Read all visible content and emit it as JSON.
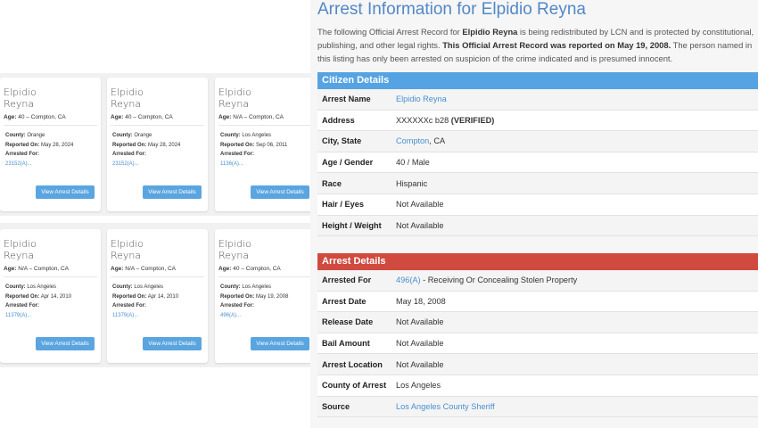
{
  "cards": [
    {
      "first": "Elpidio",
      "last": "Reyna",
      "age_label": "Age:",
      "age_text": "40 – Compton, CA",
      "county_label": "County:",
      "county": "Orange",
      "reported_label": "Reported On:",
      "reported": "May 28, 2024",
      "arrested_label": "Arrested For:",
      "code": "23152(A)...",
      "button": "View Arrest Details"
    },
    {
      "first": "Elpidio",
      "last": "Reyna",
      "age_label": "Age:",
      "age_text": "40 – Compton, CA",
      "county_label": "County:",
      "county": "Orange",
      "reported_label": "Reported On:",
      "reported": "May 28, 2024",
      "arrested_label": "Arrested For:",
      "code": "23152(A)...",
      "button": "View Arrest Details"
    },
    {
      "first": "Elpidio",
      "last": "Reyna",
      "age_label": "Age:",
      "age_text": "N/A – Compton, CA",
      "county_label": "County:",
      "county": "Los Angeles",
      "reported_label": "Reported On:",
      "reported": "Sep 06, 2011",
      "arrested_label": "Arrested For:",
      "code": "1136(A)...",
      "button": "View Arrest Details"
    },
    {
      "first": "Elpidio",
      "last": "Reyna",
      "age_label": "Age:",
      "age_text": "N/A – Compton, CA",
      "county_label": "County:",
      "county": "Los Angeles",
      "reported_label": "Reported On:",
      "reported": "Apr 14, 2010",
      "arrested_label": "Arrested For:",
      "code": "11379(A)...",
      "button": "View Arrest Details"
    },
    {
      "first": "Elpidio",
      "last": "Reyna",
      "age_label": "Age:",
      "age_text": "N/A – Compton, CA",
      "county_label": "County:",
      "county": "Los Angeles",
      "reported_label": "Reported On:",
      "reported": "Apr 14, 2010",
      "arrested_label": "Arrested For:",
      "code": "11379(A)...",
      "button": "View Arrest Details"
    },
    {
      "first": "Elpidio",
      "last": "Reyna",
      "age_label": "Age:",
      "age_text": "40 – Compton, CA",
      "county_label": "County:",
      "county": "Los Angeles",
      "reported_label": "Reported On:",
      "reported": "May 19, 2008",
      "arrested_label": "Arrested For:",
      "code": "496(A)...",
      "button": "View Arrest Details"
    }
  ],
  "detail": {
    "title": "Arrest Information for Elpidio Reyna",
    "intro": {
      "p1": "The following Official Arrest Record for ",
      "name": "Elpidio Reyna",
      "p2": " is being redistributed by LCN and is protected by constitutional, publishing, and other legal rights. ",
      "bold": "This Official Arrest Record was reported on May 19, 2008.",
      "p3": " The person named in this listing has only been arrested on suspicion of the crime indicated and is presumed innocent."
    },
    "citizen_header": "Citizen Details",
    "citizen": {
      "name_label": "Arrest Name",
      "name": "Elpidio Reyna",
      "address_label": "Address",
      "address": "XXXXXXc b28 ",
      "address_verified": "(VERIFIED)",
      "city_label": "City, State",
      "city": "Compton",
      "state": ", CA",
      "age_label": "Age / Gender",
      "age": "40 / Male",
      "race_label": "Race",
      "race": "Hispanic",
      "hair_label": "Hair / Eyes",
      "hair": "Not Available",
      "height_label": "Height / Weight",
      "height": "Not Available"
    },
    "arrest_header": "Arrest Details",
    "arrest": {
      "for_label": "Arrested For",
      "code": "496(A)",
      "offense": " - Receiving Or Concealing Stolen Property",
      "date_label": "Arrest Date",
      "date": "May 18, 2008",
      "release_label": "Release Date",
      "release": "Not Available",
      "bail_label": "Bail Amount",
      "bail": "Not Available",
      "location_label": "Arrest Location",
      "location": "Not Available",
      "county_label": "County of Arrest",
      "county": "Los Angeles",
      "source_label": "Source",
      "source": "Los Angeles County Sheriff"
    }
  },
  "colors": {
    "title_blue": "#5287c7",
    "citizen_header": "#55a3e2",
    "arrest_header": "#d04a3f",
    "button_blue": "#5aa5e0",
    "link_blue": "#4a8fcf"
  }
}
